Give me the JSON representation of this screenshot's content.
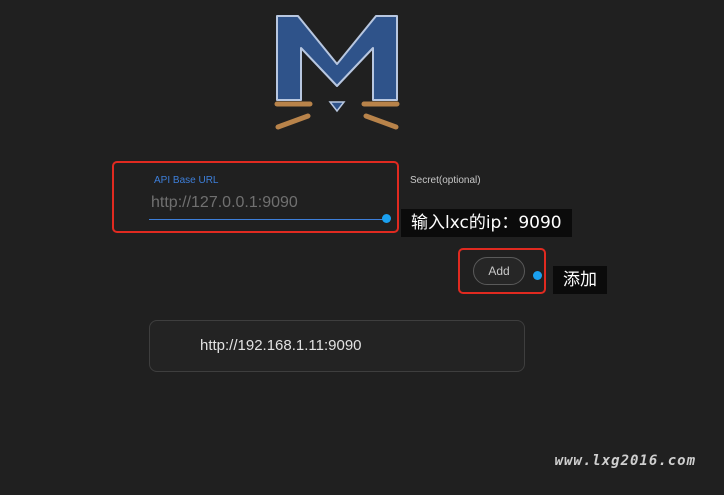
{
  "logo": {
    "icon": "metacubex-cat-logo",
    "colors": {
      "body": "#2f538a",
      "outline": "#b8c7e0",
      "whiskers": "#b8834a"
    }
  },
  "form": {
    "api_label": "API Base URL",
    "api_placeholder": "http://127.0.0.1:9090",
    "api_value": "",
    "secret_label": "Secret(optional)",
    "add_label": "Add"
  },
  "servers": [
    {
      "url": "http://192.168.1.11:9090"
    }
  ],
  "annotations": {
    "input_hint": "输入lxc的ip：9090",
    "add_hint": "添加"
  },
  "watermark": "www.lxg2016.com",
  "colors": {
    "accent": "#3d7ed8",
    "annotation_border": "#e02a20",
    "annotation_dot": "#1aa0f0",
    "background": "#202020"
  }
}
